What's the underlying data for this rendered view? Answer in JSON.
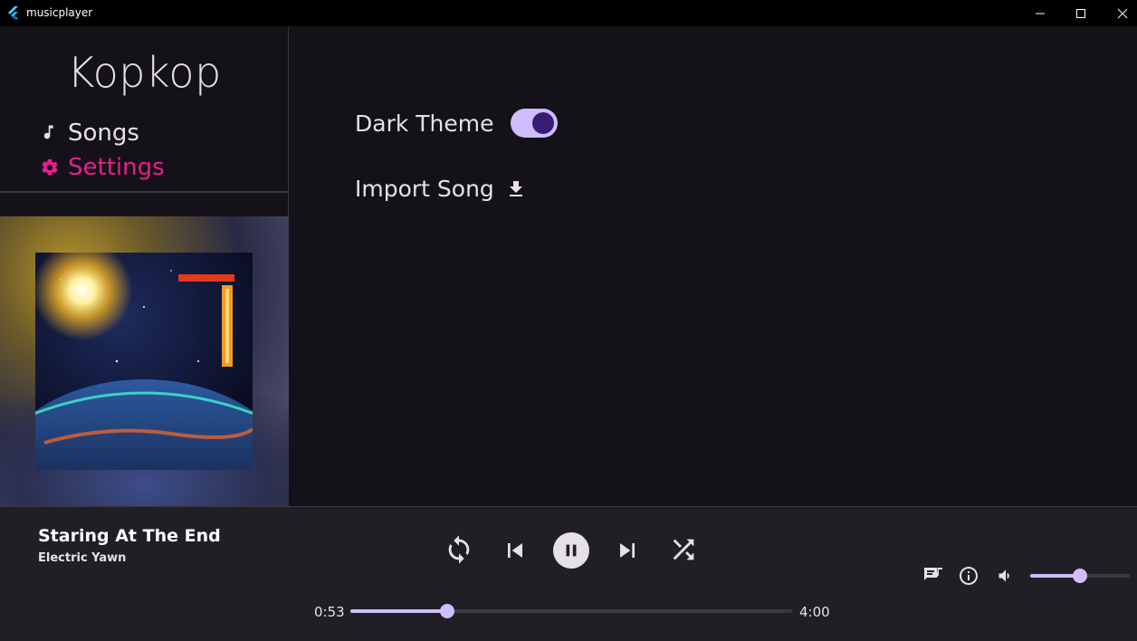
{
  "window": {
    "title": "musicplayer"
  },
  "sidebar": {
    "brand": "Kopkop",
    "items": [
      {
        "label": "Songs",
        "icon": "music-note-icon",
        "active": false
      },
      {
        "label": "Settings",
        "icon": "gear-icon",
        "active": true
      }
    ]
  },
  "settings": {
    "dark_theme_label": "Dark Theme",
    "dark_theme_enabled": true,
    "import_song_label": "Import Song"
  },
  "player": {
    "title": "Staring At The End",
    "artist": "Electric Yawn",
    "elapsed": "0:53",
    "total": "4:00",
    "progress_fraction": 0.22,
    "volume_fraction": 0.5,
    "is_playing": true
  },
  "colors": {
    "background": "#141218",
    "player_background": "#211f26",
    "accent": "#cfbdfe",
    "active_nav": "#e91e8c",
    "toggle_knob": "#381e72"
  }
}
